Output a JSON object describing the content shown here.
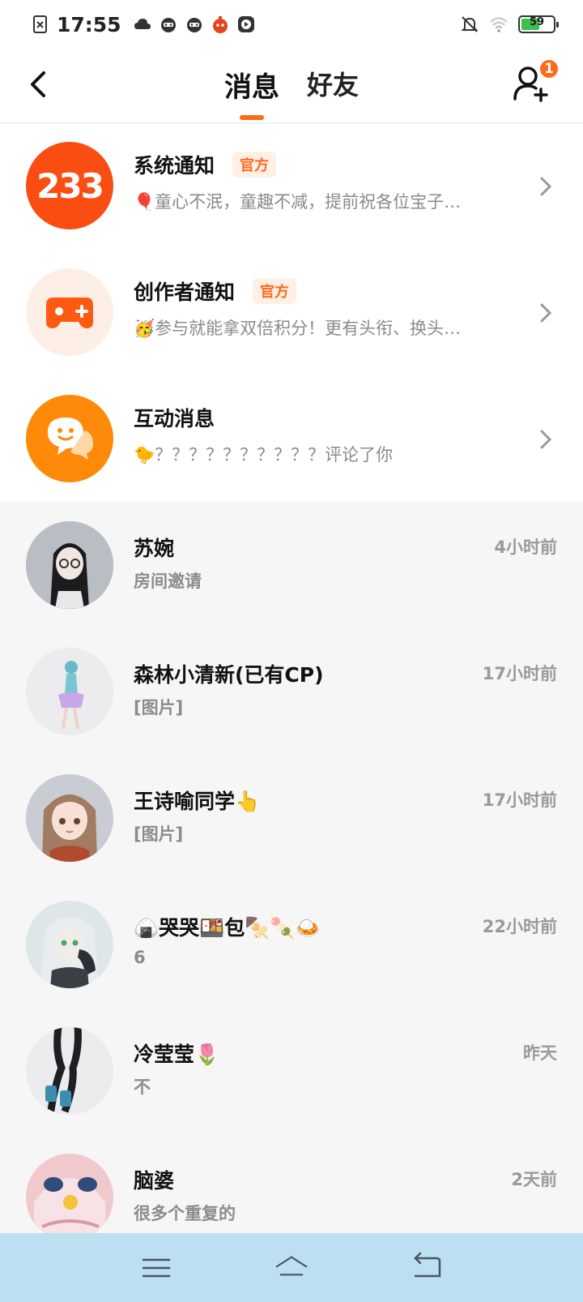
{
  "status_bar": {
    "time": "17:55",
    "battery_level": "59",
    "icons": [
      "sim-off-icon",
      "cloud-icon",
      "app-icon",
      "app-icon",
      "game-icon",
      "video-icon",
      "bell-off-icon",
      "wifi-icon",
      "battery-icon"
    ]
  },
  "header": {
    "tabs": [
      {
        "label": "消息",
        "active": true
      },
      {
        "label": "好友",
        "active": false
      }
    ],
    "add_friend_badge": "1"
  },
  "notifications": [
    {
      "avatar_text": "233",
      "title": "系统通知",
      "tag": "官方",
      "preview": "🎈童心不泯，童趣不减，提前祝各位宝子…",
      "icon": "system-233-icon"
    },
    {
      "title": "创作者通知",
      "tag": "官方",
      "preview": "🥳参与就能拿双倍积分！更有头衔、换头…",
      "icon": "gamepad-icon"
    },
    {
      "title": "互动消息",
      "tag": "",
      "preview": "🐤？？？？？？？？？？评论了你",
      "icon": "chat-bubble-icon"
    }
  ],
  "conversations": [
    {
      "name": "苏婉",
      "preview": "房间邀请",
      "time": "4小时前"
    },
    {
      "name": "森林小清新(已有CP)",
      "preview": "[图片]",
      "time": "17小时前"
    },
    {
      "name": "王诗喻同学👆",
      "preview": "[图片]",
      "time": "17小时前"
    },
    {
      "name": "🍙哭哭🍱包🍢🍡🍛",
      "preview": "6",
      "time": "22小时前"
    },
    {
      "name": "冷莹莹🌷",
      "preview": "不",
      "time": "昨天"
    },
    {
      "name": "脑婆",
      "preview": "很多个重复的",
      "time": "2天前"
    }
  ],
  "colors": {
    "accent": "#ff6a1a",
    "tag_bg": "#fff0e6",
    "nav_bar": "#bcdff2",
    "battery": "#3cc24a"
  }
}
